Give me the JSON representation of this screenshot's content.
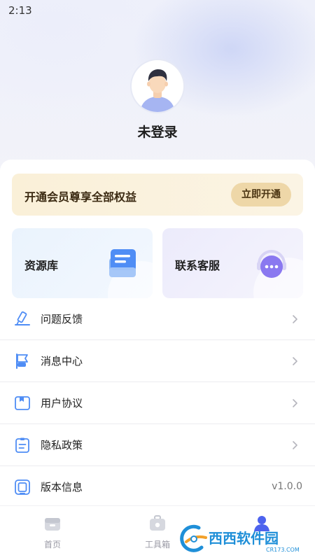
{
  "status_bar": {
    "time": "2:13"
  },
  "profile": {
    "username": "未登录"
  },
  "vip_banner": {
    "text": "开通会员尊享全部权益",
    "button_label": "立即开通"
  },
  "cards": [
    {
      "label": "资源库",
      "icon": "resource-library-icon"
    },
    {
      "label": "联系客服",
      "icon": "customer-service-icon"
    }
  ],
  "menu": {
    "items": [
      {
        "label": "问题反馈",
        "icon": "feedback-icon"
      },
      {
        "label": "消息中心",
        "icon": "flag-icon"
      },
      {
        "label": "用户协议",
        "icon": "agreement-icon"
      },
      {
        "label": "隐私政策",
        "icon": "privacy-icon"
      },
      {
        "label": "版本信息",
        "icon": "version-icon",
        "value": "v1.0.0"
      }
    ]
  },
  "tabbar": {
    "tabs": [
      {
        "label": "首页",
        "icon": "home-icon"
      },
      {
        "label": "工具箱",
        "icon": "toolbox-icon"
      },
      {
        "label": "",
        "icon": "profile-icon",
        "active": true
      }
    ]
  },
  "watermark": {
    "brand": "西西软件园",
    "domain": "CR173.COM"
  },
  "colors": {
    "accent": "#4d63ee",
    "vip_bg": "#faf0d8",
    "vip_button": "#eed7a8",
    "icon_blue": "#4f8df5",
    "icon_purple": "#8a78f0"
  }
}
